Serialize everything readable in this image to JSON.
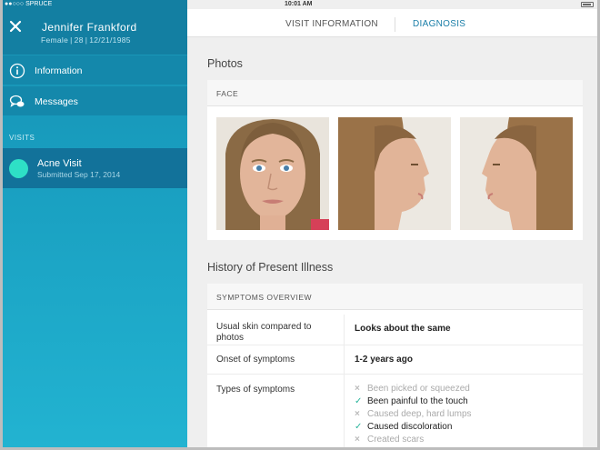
{
  "status_bar": {
    "carrier": "●●○○○ SPRUCE",
    "time": "10:01 AM"
  },
  "patient": {
    "name": "Jennifer Frankford",
    "sex": "Female",
    "age": "28",
    "dob": "12/21/1985"
  },
  "nav": [
    {
      "label": "Information",
      "icon": "info-icon"
    },
    {
      "label": "Messages",
      "icon": "messages-icon"
    }
  ],
  "visits": {
    "header": "VISITS",
    "items": [
      {
        "title": "Acne Visit",
        "subtitle": "Submitted Sep 17, 2014"
      }
    ]
  },
  "tabs": [
    {
      "label": "VISIT INFORMATION",
      "active": false
    },
    {
      "label": "DIAGNOSIS",
      "active": true
    }
  ],
  "photos": {
    "title": "Photos",
    "card_header": "FACE",
    "items": [
      "front-face-photo",
      "right-profile-photo",
      "left-profile-photo"
    ]
  },
  "history": {
    "title": "History of Present Illness",
    "card_header": "SYMPTOMS OVERVIEW",
    "rows": [
      {
        "label": "Usual skin compared to photos",
        "value": "Looks about the same"
      },
      {
        "label": "Onset of symptoms",
        "value": "1-2 years ago"
      }
    ],
    "types_label": "Types of symptoms",
    "types": [
      {
        "label": "Been picked or squeezed",
        "checked": false
      },
      {
        "label": "Been painful to the touch",
        "checked": true
      },
      {
        "label": "Caused deep, hard lumps",
        "checked": false
      },
      {
        "label": "Caused discoloration",
        "checked": true
      },
      {
        "label": "Created scars",
        "checked": false
      }
    ]
  },
  "colors": {
    "sidebar": "#1590b3",
    "accent": "#1a7ea8",
    "visit_dot": "#2ee0c6",
    "check": "#2bb59c"
  }
}
